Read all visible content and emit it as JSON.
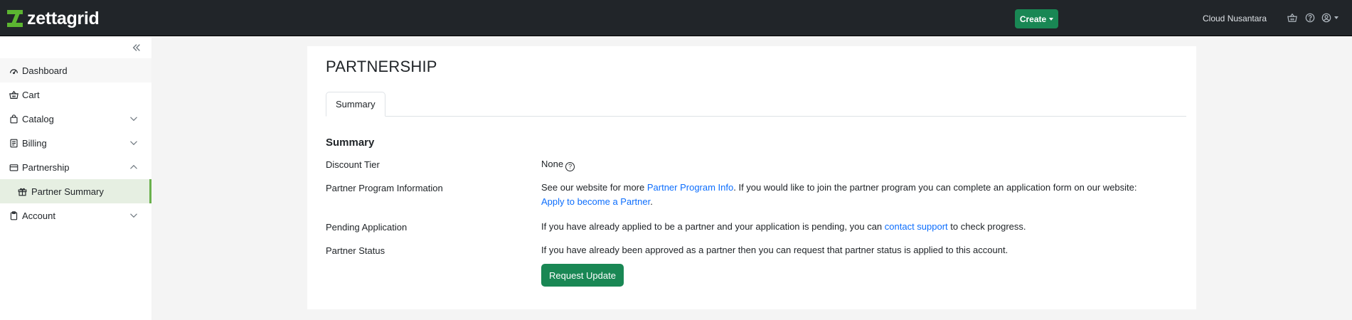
{
  "header": {
    "logo_text": "zettagrid",
    "create_label": "Create",
    "account_name": "Cloud Nusantara",
    "icons": [
      "basket-icon",
      "help-icon",
      "user-circle-icon"
    ]
  },
  "sidebar": {
    "items": [
      {
        "label": "Dashboard",
        "icon": "dashboard-icon"
      },
      {
        "label": "Cart",
        "icon": "basket-icon"
      },
      {
        "label": "Catalog",
        "icon": "bag-icon",
        "expanded": false
      },
      {
        "label": "Billing",
        "icon": "receipt-icon",
        "expanded": false
      },
      {
        "label": "Partnership",
        "icon": "wallet-icon",
        "expanded": true
      },
      {
        "label": "Partner Summary",
        "icon": "gift-icon",
        "active": true
      },
      {
        "label": "Account",
        "icon": "clipboard-icon",
        "expanded": false
      }
    ]
  },
  "main": {
    "title": "PARTNERSHIP",
    "tabs": [
      {
        "label": "Summary",
        "active": true
      }
    ],
    "section_heading": "Summary",
    "rows": {
      "discount_tier": {
        "label": "Discount Tier",
        "value": "None"
      },
      "program_info": {
        "label": "Partner Program Information",
        "text_before": "See our website for more ",
        "link1": "Partner Program Info",
        "text_middle": ". If you would like to join the partner program you can complete an application form on our website:",
        "link2": "Apply to become a Partner",
        "text_after": "."
      },
      "pending": {
        "label": "Pending Application",
        "text_before": "If you have already applied to be a partner and your application is pending, you can ",
        "link": "contact support",
        "text_after": " to check progress."
      },
      "status": {
        "label": "Partner Status",
        "text": "If you have already been approved as a partner then you can request that partner status is applied to this account.",
        "button_label": "Request Update"
      }
    }
  },
  "colors": {
    "topbar": "#212529",
    "primary_green": "#198754",
    "brand_green": "#5cb531",
    "link": "#0d6efd",
    "active_nav_bg": "#e6efe2",
    "page_bg": "#f4f4f4"
  }
}
